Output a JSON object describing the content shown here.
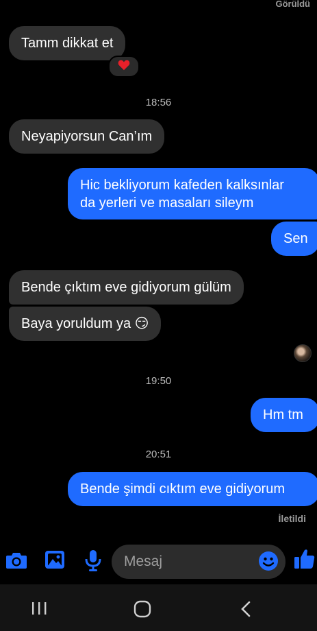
{
  "header": {
    "seen_label": "Görüldü"
  },
  "messages": [
    {
      "id": "m1",
      "text": "Tamm dikkat et",
      "reaction": "heart"
    },
    {
      "id": "t1",
      "time": "18:56"
    },
    {
      "id": "m2",
      "text": "Neyapiyorsun Can’ım"
    },
    {
      "id": "m3",
      "line1": "Hic bekliyorum kafeden kalksınlar",
      "line2": "da yerleri ve masaları sileym"
    },
    {
      "id": "m4",
      "text": "Sen"
    },
    {
      "id": "m5",
      "text": "Bende çıktım eve gidiyorum gülüm"
    },
    {
      "id": "m6",
      "text": "Baya yoruldum ya 😏"
    },
    {
      "id": "t2",
      "time": "19:50"
    },
    {
      "id": "m7",
      "text": "Hm tm"
    },
    {
      "id": "t3",
      "time": "20:51"
    },
    {
      "id": "m8",
      "text": "Bende şimdi cıktım eve gidiyorum"
    }
  ],
  "footer_status": "İletildi",
  "composer": {
    "placeholder": "Mesaj",
    "icons": [
      "camera-icon",
      "gallery-icon",
      "microphone-icon",
      "emoji-icon",
      "thumbs-up-icon"
    ],
    "accent": "#1f6bff"
  },
  "navbar": {
    "icons": [
      "recent-apps-icon",
      "home-icon",
      "back-icon"
    ]
  }
}
